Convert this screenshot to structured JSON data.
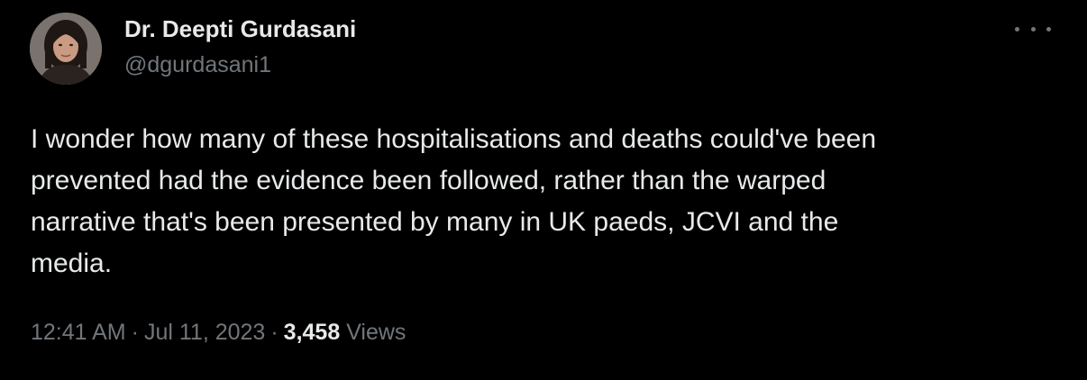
{
  "author": {
    "name": "Dr. Deepti Gurdasani",
    "handle": "@dgurdasani1"
  },
  "tweet": {
    "text": "I wonder how many of these hospitalisations and deaths could've been\nprevented had the evidence been followed, rather than the warped\nnarrative that's been presented by many in UK paeds, JCVI and the\nmedia.",
    "time": "12:41 AM",
    "date": "Jul 11, 2023",
    "separator": "·",
    "views_count": "3,458",
    "views_label": "Views"
  },
  "icons": {
    "more": "more-horizontal-icon",
    "avatar": "profile-photo"
  },
  "colors": {
    "background": "#000000",
    "primary_text": "#e7e9ea",
    "secondary_text": "#71767b"
  }
}
